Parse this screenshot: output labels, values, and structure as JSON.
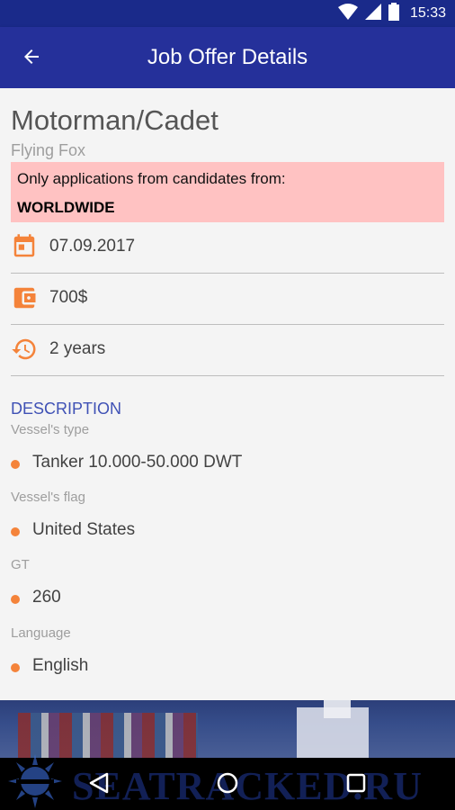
{
  "status_bar": {
    "time": "15:33"
  },
  "app_bar": {
    "title": "Job Offer Details"
  },
  "job": {
    "title": "Motorman/Cadet",
    "company": "Flying Fox",
    "notice": {
      "text": "Only applications from candidates from:",
      "region": "WORLDWIDE"
    },
    "info": {
      "date": "07.09.2017",
      "salary": "700$",
      "duration": "2 years"
    }
  },
  "description": {
    "header": "DESCRIPTION",
    "fields": [
      {
        "label": "Vessel's type",
        "value": "Tanker 10.000-50.000 DWT"
      },
      {
        "label": "Vessel's flag",
        "value": "United States"
      },
      {
        "label": "GT",
        "value": "260"
      },
      {
        "label": "Language",
        "value": "English"
      }
    ]
  },
  "watermark": {
    "text": "SEATRACKED.RU"
  },
  "colors": {
    "app_bar": "#25309a",
    "status_bar": "#1a2a8a",
    "accent": "#f4833a",
    "notice_bg": "#ffc2c2",
    "section_header": "#3f51b5"
  },
  "icons": [
    "arrow-back-icon",
    "calendar-icon",
    "wallet-icon",
    "history-icon",
    "wifi-icon",
    "signal-icon",
    "battery-icon",
    "nav-back-icon",
    "nav-home-icon",
    "nav-recents-icon"
  ]
}
